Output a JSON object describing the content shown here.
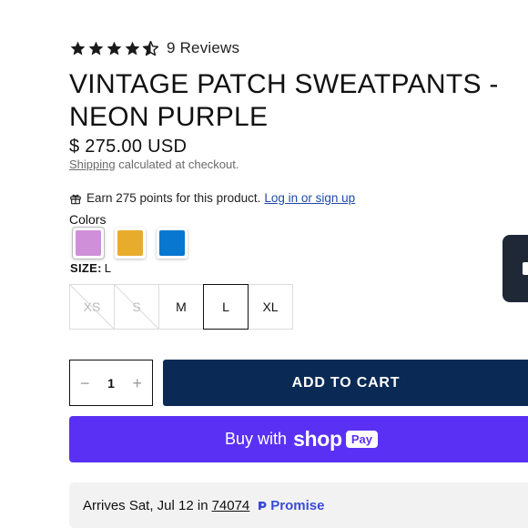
{
  "rating": {
    "value": 4.5,
    "max": 5,
    "reviews_label": "9 Reviews"
  },
  "product": {
    "title": "VINTAGE PATCH SWEATPANTS - NEON PURPLE",
    "price": "$ 275.00 USD"
  },
  "shipping": {
    "link_label": "Shipping",
    "suffix": "calculated at checkout."
  },
  "rewards": {
    "icon": "gift-icon",
    "text": "Earn 275 points for this product.",
    "link_label": "Log in or sign up"
  },
  "colors": {
    "label": "Colors",
    "options": [
      {
        "name": "purple",
        "hex": "#cf8fd9",
        "selected": true
      },
      {
        "name": "gold",
        "hex": "#e8ac2c",
        "selected": false
      },
      {
        "name": "blue",
        "hex": "#0777cf",
        "selected": false
      }
    ]
  },
  "size": {
    "label": "SIZE:",
    "selected_value": "L",
    "options": [
      {
        "label": "XS",
        "available": false,
        "selected": false
      },
      {
        "label": "S",
        "available": false,
        "selected": false
      },
      {
        "label": "M",
        "available": true,
        "selected": false
      },
      {
        "label": "L",
        "available": true,
        "selected": true
      },
      {
        "label": "XL",
        "available": true,
        "selected": false
      }
    ]
  },
  "quantity": {
    "minus": "−",
    "value": "1",
    "plus": "+"
  },
  "buttons": {
    "add_to_cart": "ADD TO CART",
    "shop_pay_prefix": "Buy with",
    "shop_pay_brand": "shop",
    "shop_pay_badge": "Pay"
  },
  "delivery": {
    "text": "Arrives Sat, Jul 12 in",
    "zip": "74074",
    "brand": "Promise"
  },
  "colors_theme": {
    "cart_button": "#0a2a55",
    "shop_pay": "#5a31f4",
    "link": "#1f4aa8",
    "promise_brand": "#3a4bd8"
  }
}
